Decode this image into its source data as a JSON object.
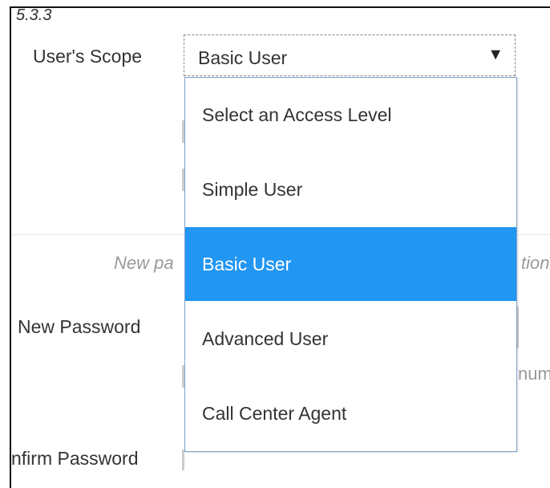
{
  "section": {
    "number": "5.3.3"
  },
  "form": {
    "scope_label": "User's Scope",
    "scope_value": "Basic User",
    "new_password_label": "New Password",
    "confirm_password_label": "nfirm Password",
    "hint_left": "New pa",
    "hint_right": "tion",
    "muted_right": "num"
  },
  "dropdown": {
    "options": [
      {
        "label": "Select an Access Level",
        "selected": false
      },
      {
        "label": "Simple User",
        "selected": false
      },
      {
        "label": "Basic User",
        "selected": true
      },
      {
        "label": "Advanced User",
        "selected": false
      },
      {
        "label": "Call Center Agent",
        "selected": false
      }
    ]
  },
  "icons": {
    "select_chevron": "chevron-down-icon",
    "chevron_glyph": "▼"
  },
  "colors": {
    "selected_option": "#2196f3",
    "dropdown_border": "#7da4cf",
    "hint_text": "#999999"
  }
}
